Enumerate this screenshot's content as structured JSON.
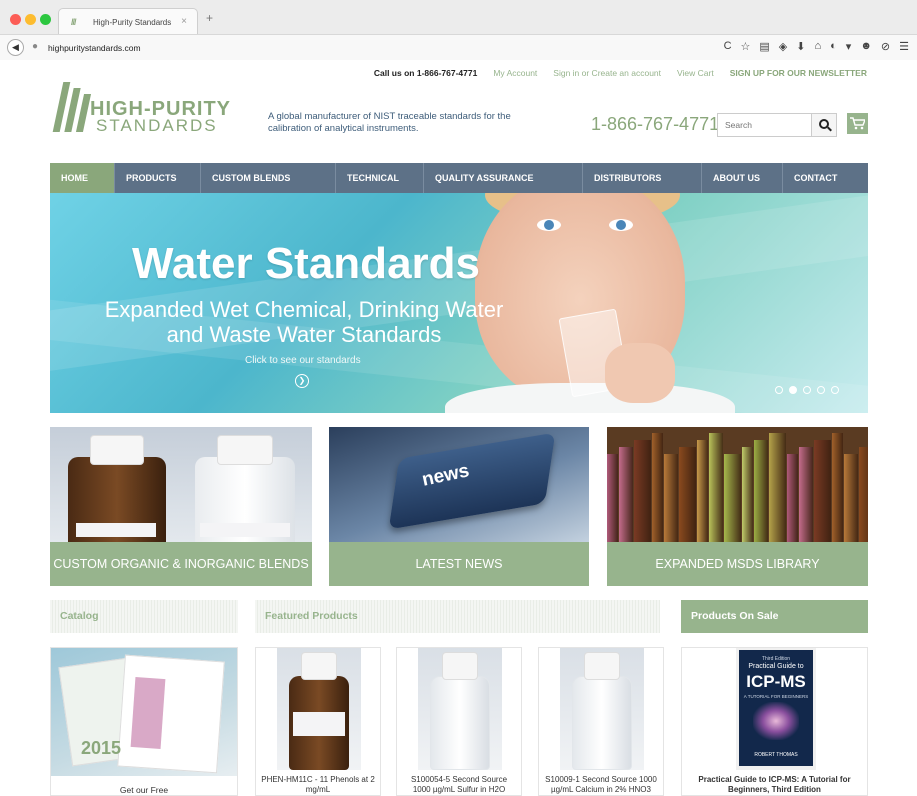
{
  "browser": {
    "tab_title": "High-Purity Standards",
    "tab_close": "×",
    "new_tab": "+",
    "url": "highpuritystandards.com",
    "toolbar_icons": [
      "C",
      "☆",
      "▤",
      "◈",
      "⬇",
      "⌂",
      "◐",
      "▾",
      "☻",
      "⊘",
      "☰"
    ]
  },
  "header": {
    "topbar": {
      "call": "Call us on 1-866-767-4771",
      "account": "My Account",
      "signin": "Sign in or Create an account",
      "cart": "View Cart",
      "newsletter": "SIGN UP FOR OUR NEWSLETTER"
    },
    "logo_line1": "HIGH-PURITY",
    "logo_line2": "STANDARDS",
    "tagline": "A global manufacturer of NIST traceable standards for the calibration of analytical instruments.",
    "phone": "1-866-767-4771",
    "search_placeholder": "Search"
  },
  "nav": {
    "items": [
      "HOME",
      "PRODUCTS",
      "CUSTOM BLENDS",
      "TECHNICAL",
      "QUALITY ASSURANCE",
      "DISTRIBUTORS",
      "ABOUT US",
      "CONTACT"
    ],
    "active": "HOME"
  },
  "hero": {
    "title": "Water Standards",
    "subtitle": "Expanded Wet Chemical, Drinking Water and Waste Water Standards",
    "cta": "Click to see our standards",
    "slide_count": 5,
    "active_slide": 2
  },
  "tiles": [
    {
      "label": "CUSTOM ORGANIC & INORGANIC BLENDS"
    },
    {
      "label": "LATEST NEWS",
      "key_text": "news"
    },
    {
      "label": "EXPANDED MSDS LIBRARY"
    }
  ],
  "sections": {
    "catalog": "Catalog",
    "featured": "Featured Products",
    "sale": "Products On Sale"
  },
  "catalog_card": {
    "year": "2015",
    "label": "Get our Free"
  },
  "featured_products": [
    {
      "name": "PHEN-HM11C - 11 Phenols at 2 mg/mL"
    },
    {
      "name": "S100054-5 Second Source 1000 µg/mL Sulfur in H2O"
    },
    {
      "name": "S10009-1 Second Source 1000 µg/mL Calcium in 2% HNO3"
    }
  ],
  "sale_product": {
    "name": "Practical Guide to ICP-MS: A Tutorial for Beginners, Third Edition",
    "cover": {
      "edition": "Third Edition",
      "title_small": "Practical Guide to",
      "title_big": "ICP-MS",
      "subtitle": "A TUTORIAL FOR BEGINNERS",
      "author": "ROBERT THOMAS"
    }
  },
  "colors": {
    "brand_green": "#97b48d",
    "nav_blue": "#5d7187",
    "tagline_blue": "#3e5d7a"
  }
}
